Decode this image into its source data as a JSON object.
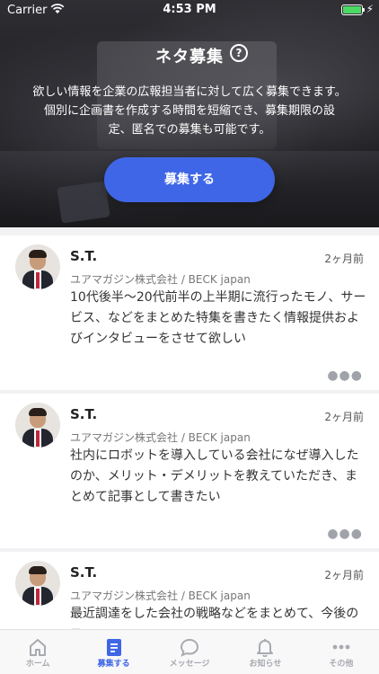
{
  "status_bar": {
    "carrier": "Carrier",
    "time": "4:53 PM"
  },
  "hero": {
    "title": "ネタ募集",
    "description": "欲しい情報を企業の広報担当者に対して広く募集できます。個別に企画書を作成する時間を短縮でき、募集期限の設定、匿名での募集も可能です。",
    "button_label": "募集する"
  },
  "posts": [
    {
      "name": "S.T.",
      "date": "2ヶ月前",
      "company": "ユアマガジン株式会社 / BECK japan",
      "body": "10代後半〜20代前半の上半期に流行ったモノ、サービス、などをまとめた特集を書きたく情報提供およびインタビューをさせて欲しい"
    },
    {
      "name": "S.T.",
      "date": "2ヶ月前",
      "company": "ユアマガジン株式会社 / BECK japan",
      "body": "社内にロボットを導入している会社になぜ導入したのか、メリット・デメリットを教えていただき、まとめて記事として書きたい"
    },
    {
      "name": "S.T.",
      "date": "2ヶ月前",
      "company": "ユアマガジン株式会社 / BECK japan",
      "body": "最近調達をした会社の戦略などをまとめて、今後のス"
    }
  ],
  "tabs": [
    {
      "label": "ホーム",
      "icon": "home-icon"
    },
    {
      "label": "募集する",
      "icon": "document-icon"
    },
    {
      "label": "メッセージ",
      "icon": "chat-bubble-icon"
    },
    {
      "label": "お知らせ",
      "icon": "bell-icon"
    },
    {
      "label": "その他",
      "icon": "more-icon"
    }
  ],
  "colors": {
    "accent": "#3f66e6",
    "battery": "#4cd964"
  }
}
